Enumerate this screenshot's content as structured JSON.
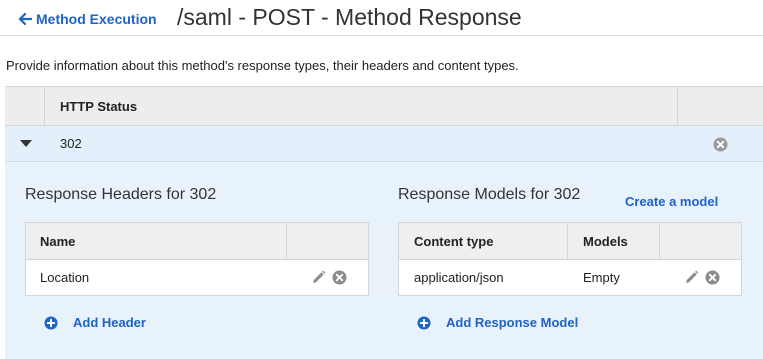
{
  "header": {
    "back_label": "Method Execution",
    "title": "/saml - POST - Method Response"
  },
  "description": "Provide information about this method's response types, their headers and content types.",
  "status_table": {
    "column_header": "HTTP Status",
    "rows": [
      {
        "code": "302"
      }
    ]
  },
  "response_headers": {
    "title": "Response Headers for 302",
    "columns": [
      "Name"
    ],
    "rows": [
      {
        "name": "Location"
      }
    ],
    "add_label": "Add Header"
  },
  "response_models": {
    "title": "Response Models for 302",
    "create_label": "Create a model",
    "columns": [
      "Content type",
      "Models"
    ],
    "rows": [
      {
        "content_type": "application/json",
        "model": "Empty"
      }
    ],
    "add_label": "Add Response Model"
  },
  "colors": {
    "link": "#1f63c6",
    "expanded_bg": "#e8f2fb",
    "selected_row_bg": "#e3effa"
  },
  "icons": {
    "back": "arrow-left-icon",
    "expand": "caret-down-icon",
    "remove": "remove-circle-icon",
    "edit": "pencil-icon",
    "add": "plus-circle-icon"
  }
}
